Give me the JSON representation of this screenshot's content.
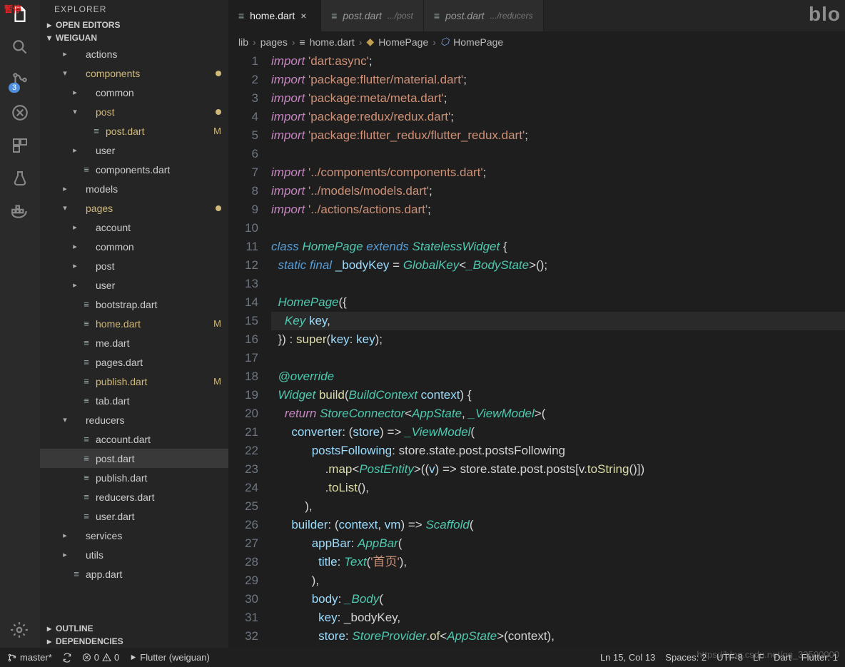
{
  "pause_label": "暂停",
  "watermark_top": "blo",
  "watermark_bottom_url": "https://blog.csdn.net/qq_33500000",
  "activity": {
    "scm_badge": "3"
  },
  "sidebar": {
    "title": "EXPLORER",
    "sections": {
      "open_editors": "OPEN EDITORS",
      "project": "WEIGUAN",
      "outline": "OUTLINE",
      "dependencies": "DEPENDENCIES"
    }
  },
  "tree": [
    {
      "depth": 1,
      "chev": "▸",
      "icon": "",
      "label": "actions",
      "colored": false,
      "mark": "",
      "dot": false
    },
    {
      "depth": 1,
      "chev": "▾",
      "icon": "",
      "label": "components",
      "colored": true,
      "mark": "",
      "dot": true
    },
    {
      "depth": 2,
      "chev": "▸",
      "icon": "",
      "label": "common",
      "colored": false,
      "mark": "",
      "dot": false
    },
    {
      "depth": 2,
      "chev": "▾",
      "icon": "",
      "label": "post",
      "colored": true,
      "mark": "",
      "dot": true
    },
    {
      "depth": 3,
      "chev": "",
      "icon": "≡",
      "label": "post.dart",
      "colored": true,
      "mark": "M",
      "dot": false
    },
    {
      "depth": 2,
      "chev": "▸",
      "icon": "",
      "label": "user",
      "colored": false,
      "mark": "",
      "dot": false
    },
    {
      "depth": 2,
      "chev": "",
      "icon": "≡",
      "label": "components.dart",
      "colored": false,
      "mark": "",
      "dot": false
    },
    {
      "depth": 1,
      "chev": "▸",
      "icon": "",
      "label": "models",
      "colored": false,
      "mark": "",
      "dot": false
    },
    {
      "depth": 1,
      "chev": "▾",
      "icon": "",
      "label": "pages",
      "colored": true,
      "mark": "",
      "dot": true
    },
    {
      "depth": 2,
      "chev": "▸",
      "icon": "",
      "label": "account",
      "colored": false,
      "mark": "",
      "dot": false
    },
    {
      "depth": 2,
      "chev": "▸",
      "icon": "",
      "label": "common",
      "colored": false,
      "mark": "",
      "dot": false
    },
    {
      "depth": 2,
      "chev": "▸",
      "icon": "",
      "label": "post",
      "colored": false,
      "mark": "",
      "dot": false
    },
    {
      "depth": 2,
      "chev": "▸",
      "icon": "",
      "label": "user",
      "colored": false,
      "mark": "",
      "dot": false
    },
    {
      "depth": 2,
      "chev": "",
      "icon": "≡",
      "label": "bootstrap.dart",
      "colored": false,
      "mark": "",
      "dot": false
    },
    {
      "depth": 2,
      "chev": "",
      "icon": "≡",
      "label": "home.dart",
      "colored": true,
      "mark": "M",
      "dot": false
    },
    {
      "depth": 2,
      "chev": "",
      "icon": "≡",
      "label": "me.dart",
      "colored": false,
      "mark": "",
      "dot": false
    },
    {
      "depth": 2,
      "chev": "",
      "icon": "≡",
      "label": "pages.dart",
      "colored": false,
      "mark": "",
      "dot": false
    },
    {
      "depth": 2,
      "chev": "",
      "icon": "≡",
      "label": "publish.dart",
      "colored": true,
      "mark": "M",
      "dot": false
    },
    {
      "depth": 2,
      "chev": "",
      "icon": "≡",
      "label": "tab.dart",
      "colored": false,
      "mark": "",
      "dot": false
    },
    {
      "depth": 1,
      "chev": "▾",
      "icon": "",
      "label": "reducers",
      "colored": false,
      "mark": "",
      "dot": false
    },
    {
      "depth": 2,
      "chev": "",
      "icon": "≡",
      "label": "account.dart",
      "colored": false,
      "mark": "",
      "dot": false
    },
    {
      "depth": 2,
      "chev": "",
      "icon": "≡",
      "label": "post.dart",
      "colored": false,
      "mark": "",
      "dot": false,
      "selected": true
    },
    {
      "depth": 2,
      "chev": "",
      "icon": "≡",
      "label": "publish.dart",
      "colored": false,
      "mark": "",
      "dot": false
    },
    {
      "depth": 2,
      "chev": "",
      "icon": "≡",
      "label": "reducers.dart",
      "colored": false,
      "mark": "",
      "dot": false
    },
    {
      "depth": 2,
      "chev": "",
      "icon": "≡",
      "label": "user.dart",
      "colored": false,
      "mark": "",
      "dot": false
    },
    {
      "depth": 1,
      "chev": "▸",
      "icon": "",
      "label": "services",
      "colored": false,
      "mark": "",
      "dot": false
    },
    {
      "depth": 1,
      "chev": "▸",
      "icon": "",
      "label": "utils",
      "colored": false,
      "mark": "",
      "dot": false
    },
    {
      "depth": 1,
      "chev": "",
      "icon": "≡",
      "label": "app.dart",
      "colored": false,
      "mark": "",
      "dot": false
    }
  ],
  "tabs": [
    {
      "icon": "≡",
      "label": "home.dart",
      "hint": "",
      "active": true,
      "close": true
    },
    {
      "icon": "≡",
      "label": "post.dart",
      "hint": ".../post",
      "active": false,
      "close": false
    },
    {
      "icon": "≡",
      "label": "post.dart",
      "hint": ".../reducers",
      "active": false,
      "close": false
    }
  ],
  "breadcrumb": [
    {
      "icon": "",
      "label": "lib"
    },
    {
      "icon": "",
      "label": "pages"
    },
    {
      "icon": "≡",
      "label": "home.dart",
      "iconcls": ""
    },
    {
      "icon": "◆",
      "label": "HomePage",
      "iconcls": "bicon"
    },
    {
      "icon": "⬡",
      "label": "HomePage",
      "iconcls": "bicon cls"
    }
  ],
  "code": {
    "lines": [
      [
        {
          "c": "kw",
          "t": "import"
        },
        {
          "c": "pn",
          "t": " "
        },
        {
          "c": "str",
          "t": "'dart:async'"
        },
        {
          "c": "pn",
          "t": ";"
        }
      ],
      [
        {
          "c": "kw",
          "t": "import"
        },
        {
          "c": "pn",
          "t": " "
        },
        {
          "c": "str",
          "t": "'package:flutter/material.dart'"
        },
        {
          "c": "pn",
          "t": ";"
        }
      ],
      [
        {
          "c": "kw",
          "t": "import"
        },
        {
          "c": "pn",
          "t": " "
        },
        {
          "c": "str",
          "t": "'package:meta/meta.dart'"
        },
        {
          "c": "pn",
          "t": ";"
        }
      ],
      [
        {
          "c": "kw",
          "t": "import"
        },
        {
          "c": "pn",
          "t": " "
        },
        {
          "c": "str",
          "t": "'package:redux/redux.dart'"
        },
        {
          "c": "pn",
          "t": ";"
        }
      ],
      [
        {
          "c": "kw",
          "t": "import"
        },
        {
          "c": "pn",
          "t": " "
        },
        {
          "c": "str",
          "t": "'package:flutter_redux/flutter_redux.dart'"
        },
        {
          "c": "pn",
          "t": ";"
        }
      ],
      [],
      [
        {
          "c": "kw",
          "t": "import"
        },
        {
          "c": "pn",
          "t": " "
        },
        {
          "c": "str",
          "t": "'../components/components.dart'"
        },
        {
          "c": "pn",
          "t": ";"
        }
      ],
      [
        {
          "c": "kw",
          "t": "import"
        },
        {
          "c": "pn",
          "t": " "
        },
        {
          "c": "str",
          "t": "'../models/models.dart'"
        },
        {
          "c": "pn",
          "t": ";"
        }
      ],
      [
        {
          "c": "kw",
          "t": "import"
        },
        {
          "c": "pn",
          "t": " "
        },
        {
          "c": "str",
          "t": "'../actions/actions.dart'"
        },
        {
          "c": "pn",
          "t": ";"
        }
      ],
      [],
      [
        {
          "c": "kw2",
          "t": "class"
        },
        {
          "c": "pn",
          "t": " "
        },
        {
          "c": "cls",
          "t": "HomePage"
        },
        {
          "c": "pn",
          "t": " "
        },
        {
          "c": "kw2",
          "t": "extends"
        },
        {
          "c": "pn",
          "t": " "
        },
        {
          "c": "cls",
          "t": "StatelessWidget"
        },
        {
          "c": "pn",
          "t": " {"
        }
      ],
      [
        {
          "c": "pn",
          "t": "  "
        },
        {
          "c": "kw2",
          "t": "static"
        },
        {
          "c": "pn",
          "t": " "
        },
        {
          "c": "kw2",
          "t": "final"
        },
        {
          "c": "pn",
          "t": " "
        },
        {
          "c": "var",
          "t": "_bodyKey"
        },
        {
          "c": "pn",
          "t": " "
        },
        {
          "c": "op",
          "t": "="
        },
        {
          "c": "pn",
          "t": " "
        },
        {
          "c": "cls",
          "t": "GlobalKey"
        },
        {
          "c": "pn",
          "t": "<"
        },
        {
          "c": "cls",
          "t": "_BodyState"
        },
        {
          "c": "pn",
          "t": ">();"
        }
      ],
      [],
      [
        {
          "c": "pn",
          "t": "  "
        },
        {
          "c": "cls",
          "t": "HomePage"
        },
        {
          "c": "pn",
          "t": "({"
        }
      ],
      [
        {
          "c": "pn",
          "t": "    "
        },
        {
          "c": "cls",
          "t": "Key"
        },
        {
          "c": "pn",
          "t": " "
        },
        {
          "c": "var",
          "t": "key"
        },
        {
          "c": "pn",
          "t": ","
        }
      ],
      [
        {
          "c": "pn",
          "t": "  }) "
        },
        {
          "c": "op",
          "t": ":"
        },
        {
          "c": "pn",
          "t": " "
        },
        {
          "c": "fn",
          "t": "super"
        },
        {
          "c": "pn",
          "t": "("
        },
        {
          "c": "var",
          "t": "key"
        },
        {
          "c": "op",
          "t": ":"
        },
        {
          "c": "pn",
          "t": " "
        },
        {
          "c": "var",
          "t": "key"
        },
        {
          "c": "pn",
          "t": ");"
        }
      ],
      [],
      [
        {
          "c": "pn",
          "t": "  "
        },
        {
          "c": "ann",
          "t": "@override"
        }
      ],
      [
        {
          "c": "pn",
          "t": "  "
        },
        {
          "c": "cls",
          "t": "Widget"
        },
        {
          "c": "pn",
          "t": " "
        },
        {
          "c": "fn",
          "t": "build"
        },
        {
          "c": "pn",
          "t": "("
        },
        {
          "c": "cls",
          "t": "BuildContext"
        },
        {
          "c": "pn",
          "t": " "
        },
        {
          "c": "var",
          "t": "context"
        },
        {
          "c": "pn",
          "t": ") {"
        }
      ],
      [
        {
          "c": "pn",
          "t": "    "
        },
        {
          "c": "kw",
          "t": "return"
        },
        {
          "c": "pn",
          "t": " "
        },
        {
          "c": "cls",
          "t": "StoreConnector"
        },
        {
          "c": "pn",
          "t": "<"
        },
        {
          "c": "cls",
          "t": "AppState"
        },
        {
          "c": "pn",
          "t": ", "
        },
        {
          "c": "cls",
          "t": "_ViewModel"
        },
        {
          "c": "pn",
          "t": ">("
        }
      ],
      [
        {
          "c": "pn",
          "t": "      "
        },
        {
          "c": "var",
          "t": "converter"
        },
        {
          "c": "op",
          "t": ":"
        },
        {
          "c": "pn",
          "t": " ("
        },
        {
          "c": "var",
          "t": "store"
        },
        {
          "c": "pn",
          "t": ") "
        },
        {
          "c": "op",
          "t": "=>"
        },
        {
          "c": "pn",
          "t": " "
        },
        {
          "c": "cls",
          "t": "_ViewModel"
        },
        {
          "c": "pn",
          "t": "("
        }
      ],
      [
        {
          "c": "pn",
          "t": "            "
        },
        {
          "c": "var",
          "t": "postsFollowing"
        },
        {
          "c": "op",
          "t": ":"
        },
        {
          "c": "pn",
          "t": " store.state.post.postsFollowing"
        }
      ],
      [
        {
          "c": "pn",
          "t": "                ."
        },
        {
          "c": "fn",
          "t": "map"
        },
        {
          "c": "pn",
          "t": "<"
        },
        {
          "c": "cls",
          "t": "PostEntity"
        },
        {
          "c": "pn",
          "t": ">(("
        },
        {
          "c": "var",
          "t": "v"
        },
        {
          "c": "pn",
          "t": ") "
        },
        {
          "c": "op",
          "t": "=>"
        },
        {
          "c": "pn",
          "t": " store.state.post.posts[v."
        },
        {
          "c": "fn",
          "t": "toString"
        },
        {
          "c": "pn",
          "t": "()])"
        }
      ],
      [
        {
          "c": "pn",
          "t": "                ."
        },
        {
          "c": "fn",
          "t": "toList"
        },
        {
          "c": "pn",
          "t": "(),"
        }
      ],
      [
        {
          "c": "pn",
          "t": "          ),"
        }
      ],
      [
        {
          "c": "pn",
          "t": "      "
        },
        {
          "c": "var",
          "t": "builder"
        },
        {
          "c": "op",
          "t": ":"
        },
        {
          "c": "pn",
          "t": " ("
        },
        {
          "c": "var",
          "t": "context"
        },
        {
          "c": "pn",
          "t": ", "
        },
        {
          "c": "var",
          "t": "vm"
        },
        {
          "c": "pn",
          "t": ") "
        },
        {
          "c": "op",
          "t": "=>"
        },
        {
          "c": "pn",
          "t": " "
        },
        {
          "c": "cls",
          "t": "Scaffold"
        },
        {
          "c": "pn",
          "t": "("
        }
      ],
      [
        {
          "c": "pn",
          "t": "            "
        },
        {
          "c": "var",
          "t": "appBar"
        },
        {
          "c": "op",
          "t": ":"
        },
        {
          "c": "pn",
          "t": " "
        },
        {
          "c": "cls",
          "t": "AppBar"
        },
        {
          "c": "pn",
          "t": "("
        }
      ],
      [
        {
          "c": "pn",
          "t": "              "
        },
        {
          "c": "var",
          "t": "title"
        },
        {
          "c": "op",
          "t": ":"
        },
        {
          "c": "pn",
          "t": " "
        },
        {
          "c": "cls",
          "t": "Text"
        },
        {
          "c": "pn",
          "t": "("
        },
        {
          "c": "str",
          "t": "'首页'"
        },
        {
          "c": "pn",
          "t": "),"
        }
      ],
      [
        {
          "c": "pn",
          "t": "            ),"
        }
      ],
      [
        {
          "c": "pn",
          "t": "            "
        },
        {
          "c": "var",
          "t": "body"
        },
        {
          "c": "op",
          "t": ":"
        },
        {
          "c": "pn",
          "t": " "
        },
        {
          "c": "cls",
          "t": "_Body"
        },
        {
          "c": "pn",
          "t": "("
        }
      ],
      [
        {
          "c": "pn",
          "t": "              "
        },
        {
          "c": "var",
          "t": "key"
        },
        {
          "c": "op",
          "t": ":"
        },
        {
          "c": "pn",
          "t": " _bodyKey,"
        }
      ],
      [
        {
          "c": "pn",
          "t": "              "
        },
        {
          "c": "var",
          "t": "store"
        },
        {
          "c": "op",
          "t": ":"
        },
        {
          "c": "pn",
          "t": " "
        },
        {
          "c": "cls",
          "t": "StoreProvider"
        },
        {
          "c": "pn",
          "t": "."
        },
        {
          "c": "fn",
          "t": "of"
        },
        {
          "c": "pn",
          "t": "<"
        },
        {
          "c": "cls",
          "t": "AppState"
        },
        {
          "c": "pn",
          "t": ">(context),"
        }
      ]
    ],
    "highlight_line": 15
  },
  "status": {
    "branch": "master*",
    "errors": "0",
    "warnings": "0",
    "run": "Flutter (weiguan)",
    "cursor": "Ln 15, Col 13",
    "spaces": "Spaces: 2",
    "encoding": "UTF-8",
    "eol": "LF",
    "lang": "Dart",
    "flutter": "Flutter: 1"
  }
}
